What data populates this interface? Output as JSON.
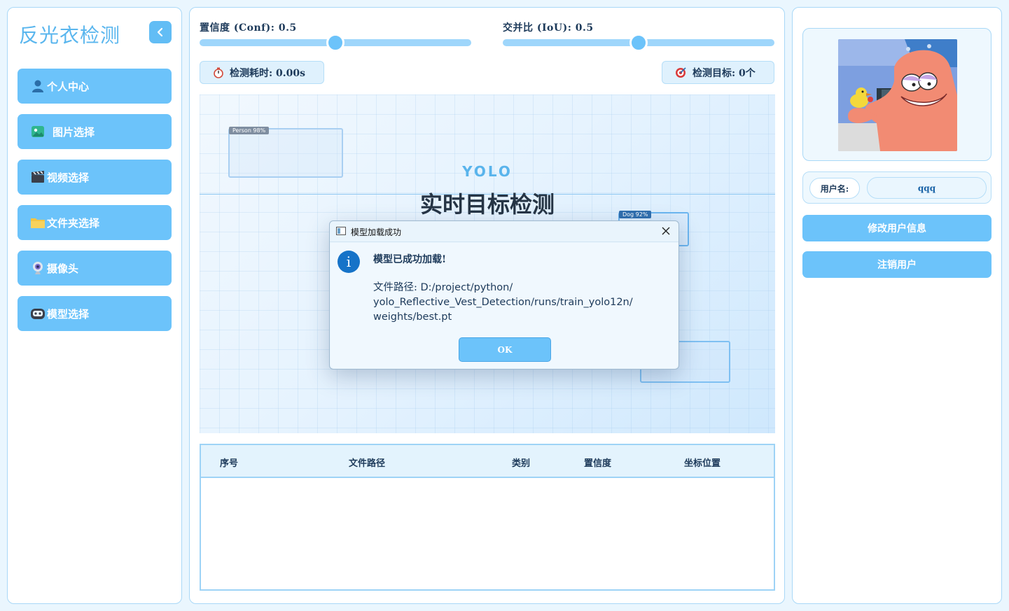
{
  "app": {
    "title": "反光衣检测"
  },
  "sidebar": {
    "items": [
      {
        "label": "个人中心",
        "icon": "user-icon"
      },
      {
        "label": "图片选择",
        "icon": "image-icon"
      },
      {
        "label": "视频选择",
        "icon": "clapperboard-icon"
      },
      {
        "label": "文件夹选择",
        "icon": "folder-icon"
      },
      {
        "label": "摄像头",
        "icon": "webcam-icon"
      },
      {
        "label": "模型选择",
        "icon": "robot-icon"
      }
    ]
  },
  "controls": {
    "conf_label": "置信度 (Conf): 0.5",
    "conf_value": 0.5,
    "iou_label": "交并比 (IoU): 0.5",
    "iou_value": 0.5
  },
  "stats": {
    "time_label": "检测耗时: 0.00s",
    "targets_label": "检测目标: 0个"
  },
  "stage": {
    "brand": "YOLO",
    "headline": "实时目标检测",
    "tag_person": "Person 98%",
    "tag_dog": "Dog 92%"
  },
  "table": {
    "columns": [
      "序号",
      "文件路径",
      "类别",
      "置信度",
      "坐标位置"
    ],
    "rows": []
  },
  "user": {
    "name_label": "用户名:",
    "name_value": "qqq",
    "edit_button": "修改用户信息",
    "logout_button": "注销用户"
  },
  "dialog": {
    "title": "模型加载成功",
    "message": "模型已成功加载!",
    "path_label": "文件路径: ",
    "path_line1": "D:/project/python/",
    "path_line2": "yolo_Reflective_Vest_Detection/runs/train_yolo12n/",
    "path_line3": "weights/best.pt",
    "ok_label": "OK"
  },
  "colors": {
    "accent": "#6cc3fa",
    "title": "#5ab6ee",
    "panel_border": "#a9d8f7",
    "info": "#1673c8"
  }
}
